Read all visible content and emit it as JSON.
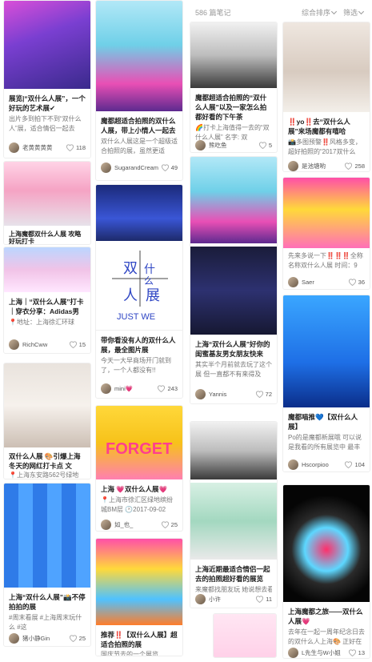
{
  "header": {
    "count": "586 篇笔记",
    "sort": "综合排序",
    "filter": "筛选"
  },
  "cards": [
    {
      "id": "c1",
      "title": "展览|“双什么人展”，一个好玩的艺术展✔",
      "desc": "出片多到拍下不到“双什么人”展，适合情侣一起去",
      "user": "老黄黄黄黄",
      "likes": "118"
    },
    {
      "id": "c2",
      "title": "上海魔都双什么人展 攻略 好玩打卡",
      "desc": "",
      "user": "",
      "likes": ""
    },
    {
      "id": "c3",
      "title": "上海｜“双什么人展”打卡｜穿衣分享：Adidas男装卫",
      "desc": "📍地址：上海徐汇环球",
      "user": "RichCww",
      "likes": "15"
    },
    {
      "id": "c4",
      "title": "双什么人展 🎨引爆上海冬天的网红打卡点 文",
      "desc": "📍上海东安路562号绿地",
      "user": "",
      "likes": ""
    },
    {
      "id": "c5",
      "title": "上海“双什么人展”📸不停拍拍的展",
      "desc": "#周末看展 #上海周末玩什么 #这",
      "user": "猪小静Gin",
      "likes": "25"
    },
    {
      "id": "c6",
      "title": "魔都超适合拍照的双什么人展，带上小情人一起去",
      "desc": "双什么人展这是一个超级适合拍照的展，虽然更适",
      "user": "SugarandCream",
      "likes": "49"
    },
    {
      "id": "c7",
      "title": "带你看没有人的双什么人展，最全图片展",
      "desc": "今天一大早商场开门就到了，一个人都没有!!",
      "user": "mini💗",
      "likes": "243"
    },
    {
      "id": "c8",
      "title": "上海 💗双什么人展💗",
      "desc": "📍上海市徐汇区绿地缤纷城BM层 🕐2017-09-02",
      "user": "如_也_",
      "likes": "25"
    },
    {
      "id": "c9",
      "title": "推荐‼️【双什么人展】超适合拍照的展",
      "desc": "国庆节去的一个展览",
      "user": "",
      "likes": ""
    },
    {
      "id": "c10",
      "title": "魔都超适合拍照的“双什么人展”以及一家怎么拍都好看的下午茶",
      "desc": "🌈打卡上海值得一去的“双什么人展” 名字: 双",
      "user": "熊吃鱼",
      "likes": "5"
    },
    {
      "id": "c11",
      "title": "上海“双什么人展”好你的闺蜜基友男女朋友快来",
      "desc": "其实半个月前就去玩了这个展 但一直都不有来得及",
      "user": "Yannis",
      "likes": "72"
    },
    {
      "id": "c12",
      "title": "上海近期最适合情侣一起去的拍照超好看的展览",
      "desc": "来魔都找朋友玩 她说想去看这个展于是拉着我来打卡",
      "user": "小许",
      "likes": "11"
    },
    {
      "id": "c13",
      "title": "‼️yo‼️去“双什么人展”来场魔都有嘻哈",
      "desc": "📸多图预警‼️风格多变，超好拍照的“2017双什么",
      "user": "是池塘哟",
      "likes": "258"
    },
    {
      "id": "c14",
      "title": "",
      "desc": "先来多说一下‼️‼️‼️全称名称双什么人展 时间：9",
      "user": "Saer",
      "likes": "36"
    },
    {
      "id": "c15",
      "title": "魔都喵推💙【双什么人展】",
      "desc": "Po的是魔都新展哦 可以说是我看的所有展览中 最丰",
      "user": "Hscorpioo",
      "likes": "104"
    },
    {
      "id": "c16",
      "title": "上海魔都之旅——双什么人展💗",
      "desc": "去年在一起一周年纪念日去的双什么人上海🎨 正好在红",
      "user": "L先生与W小姐",
      "likes": "13"
    }
  ],
  "graphics": {
    "c7_sign": [
      "双",
      "什",
      "么",
      "人",
      "展",
      "JUST WE"
    ],
    "c8_sign": "FORGET"
  },
  "colors": {
    "heart": "#aaaaaa",
    "title": "#222222",
    "desc": "#777777"
  }
}
